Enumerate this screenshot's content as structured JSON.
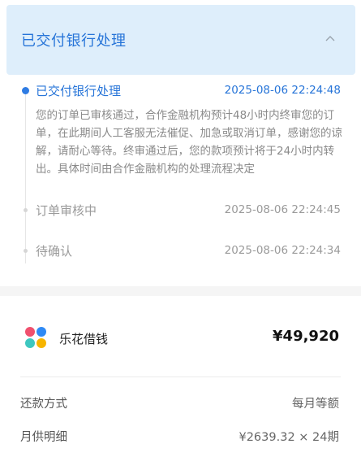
{
  "header": {
    "title": "已交付银行处理",
    "toggle_icon": "chevron-up-icon"
  },
  "timeline": [
    {
      "label": "已交付银行处理",
      "time": "2025-08-06 22:24:48",
      "description": "您的订单已审核通过，合作金融机构预计48小时内终审您的订单，在此期间人工客服无法催促、加急或取消订单，感谢您的谅解，请耐心等待。终审通过后，您的款项预计将于24小时内转出。具体时间由合作金融机构的处理流程决定",
      "active": true
    },
    {
      "label": "订单审核中",
      "time": "2025-08-06 22:24:45",
      "active": false
    },
    {
      "label": "待确认",
      "time": "2025-08-06 22:24:34",
      "active": false
    }
  ],
  "loan": {
    "product_name": "乐花借钱",
    "amount": "¥49,920",
    "logo_icon": "lehua-logo-icon",
    "logo_colors": [
      "#f0506e",
      "#2f8af5",
      "#3ec7c0",
      "#f7b500"
    ]
  },
  "details": [
    {
      "label": "还款方式",
      "value": "每月等额"
    },
    {
      "label": "月供明细",
      "value": "¥2639.32 × 24期"
    }
  ],
  "colors": {
    "accent": "#2674d8",
    "header_bg": "#deeefb",
    "muted_text": "#9a9a9a"
  }
}
